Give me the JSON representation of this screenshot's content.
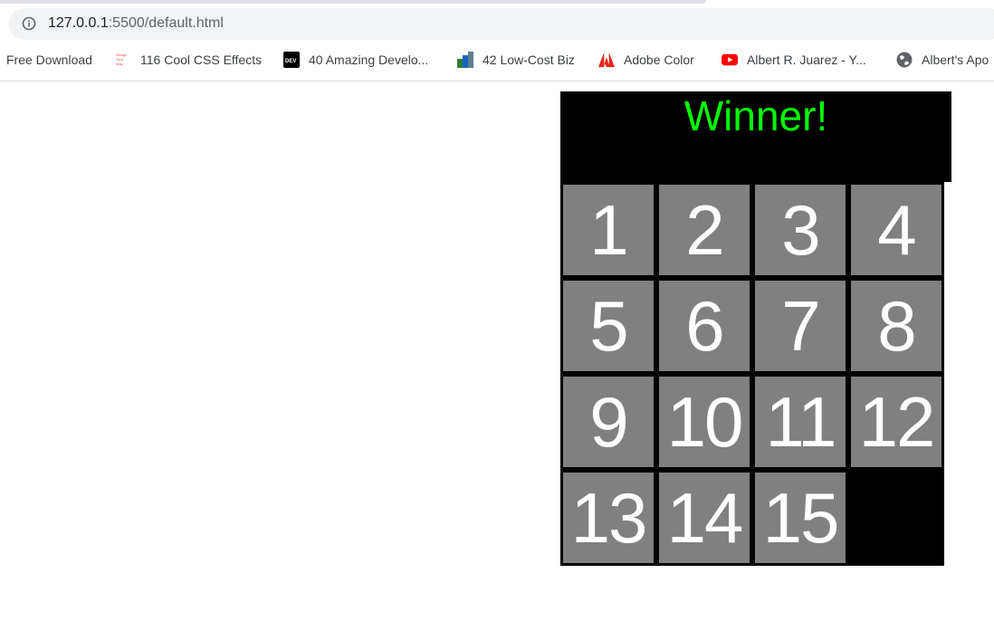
{
  "browser": {
    "url_host": "127.0.0.1",
    "url_rest": ":5500/default.html",
    "bookmarks": [
      {
        "label": "Free Download",
        "icon": "none"
      },
      {
        "label": "116 Cool CSS Effects",
        "icon": "design-your-way-icon"
      },
      {
        "label": "40 Amazing Develo...",
        "icon": "dev-icon"
      },
      {
        "label": "42 Low-Cost Biz",
        "icon": "chart-icon"
      },
      {
        "label": "Adobe Color",
        "icon": "adobe-icon"
      },
      {
        "label": "Albert R. Juarez - Y...",
        "icon": "youtube-icon"
      },
      {
        "label": "Albert's Apo",
        "icon": "globe-icon"
      }
    ]
  },
  "game": {
    "status": "Winner!",
    "status_color": "#00ff00",
    "tiles": [
      "1",
      "2",
      "3",
      "4",
      "5",
      "6",
      "7",
      "8",
      "9",
      "10",
      "11",
      "12",
      "13",
      "14",
      "15",
      ""
    ]
  }
}
